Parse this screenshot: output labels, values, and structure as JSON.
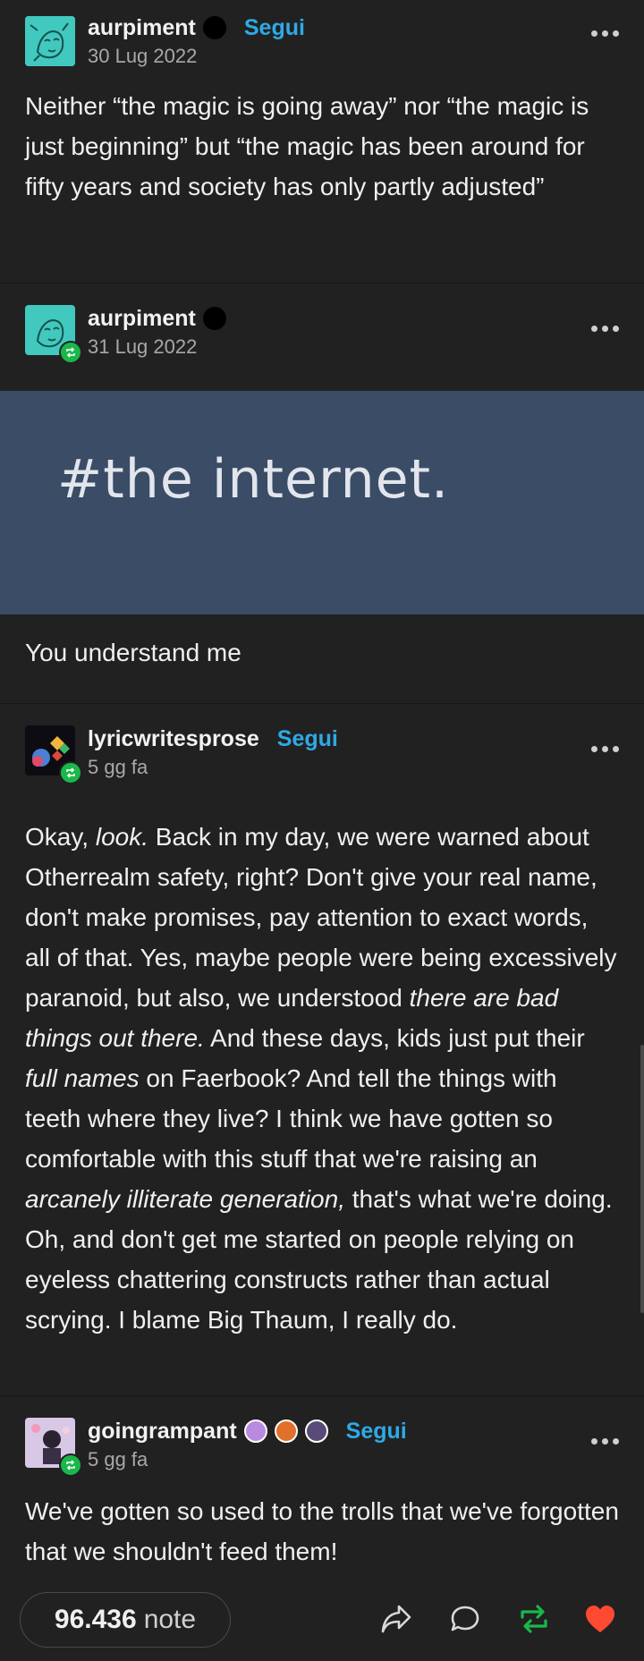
{
  "posts": [
    {
      "blogname": "aurpiment",
      "follow_label": "Segui",
      "date": "30 Lug 2022",
      "text": "Neither “the magic is going away” nor “the magic is just beginning”  but “the magic has been around for fifty years and society has only partly adjusted”"
    },
    {
      "blogname": "aurpiment",
      "date": "31 Lug 2022",
      "image_text": "#the internet.",
      "text": "You understand me"
    },
    {
      "blogname": "lyricwritesprose",
      "follow_label": "Segui",
      "date": "5 gg fa",
      "t1": "Okay, ",
      "t2": "look.",
      "t3": " Back in my day, we were warned about Otherrealm safety, right? Don't give your real name, don't make promises, pay attention to exact words, all of that. Yes, maybe people were being excessively paranoid, but also, we understood ",
      "t4": "there are bad things out there.",
      "t5": " And these days, kids just put their ",
      "t6": "full names",
      "t7": " on Faerbook? And tell the things with teeth where they live? I think we have gotten so comfortable with this stuff that we're raising an ",
      "t8": "arcanely illiterate generation,",
      "t9": " that's what we're doing. Oh, and don't get me started on people relying on eyeless chattering constructs rather than actual scrying. I blame Big Thaum, I really do."
    },
    {
      "blogname": "goingrampant",
      "follow_label": "Segui",
      "date": "5 gg fa",
      "text": "We've gotten so used to the trolls that we've forgotten that we shouldn't feed them!"
    }
  ],
  "footer": {
    "notes_count": "96.436",
    "notes_label": "note",
    "icons": [
      "share-icon",
      "reply-icon",
      "reblog-icon",
      "like-icon"
    ]
  },
  "colors": {
    "background": "#212121",
    "accent_blue": "#2fa9e6",
    "reblog_green": "#19b84a",
    "like_red": "#ff4930",
    "banner": "#3a4c66"
  }
}
